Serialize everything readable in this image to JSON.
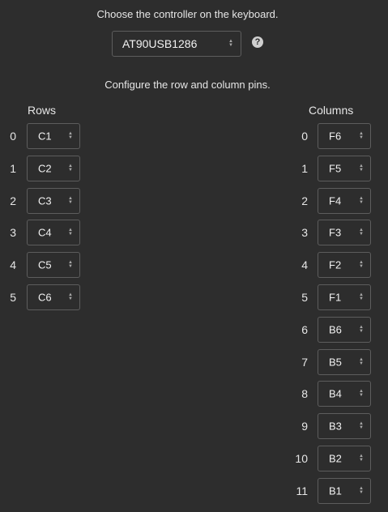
{
  "instructions": {
    "controller": "Choose the controller on the keyboard.",
    "pins": "Configure the row and column pins."
  },
  "controller_select": {
    "value": "AT90USB1286"
  },
  "help_icon": "?",
  "rows": {
    "header": "Rows",
    "items": [
      {
        "index": "0",
        "pin": "C1"
      },
      {
        "index": "1",
        "pin": "C2"
      },
      {
        "index": "2",
        "pin": "C3"
      },
      {
        "index": "3",
        "pin": "C4"
      },
      {
        "index": "4",
        "pin": "C5"
      },
      {
        "index": "5",
        "pin": "C6"
      }
    ]
  },
  "columns": {
    "header": "Columns",
    "items": [
      {
        "index": "0",
        "pin": "F6"
      },
      {
        "index": "1",
        "pin": "F5"
      },
      {
        "index": "2",
        "pin": "F4"
      },
      {
        "index": "3",
        "pin": "F3"
      },
      {
        "index": "4",
        "pin": "F2"
      },
      {
        "index": "5",
        "pin": "F1"
      },
      {
        "index": "6",
        "pin": "B6"
      },
      {
        "index": "7",
        "pin": "B5"
      },
      {
        "index": "8",
        "pin": "B4"
      },
      {
        "index": "9",
        "pin": "B3"
      },
      {
        "index": "10",
        "pin": "B2"
      },
      {
        "index": "11",
        "pin": "B1"
      }
    ]
  },
  "icons": {
    "select_arrows": "up-down-arrows-icon",
    "help": "question-circle-icon"
  }
}
